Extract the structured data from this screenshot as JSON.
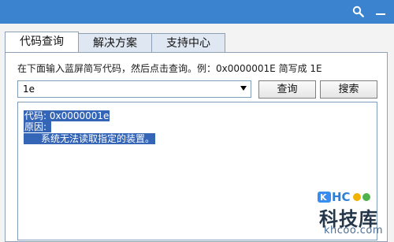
{
  "tabs": [
    {
      "label": "代码查询"
    },
    {
      "label": "解决方案"
    },
    {
      "label": "支持中心"
    }
  ],
  "instruction": "在下面输入蓝屏简写代码，然后点击查询。例：0x0000001E 简写成 1E",
  "input": {
    "value": "1e"
  },
  "buttons": {
    "query": "查询",
    "search": "搜索"
  },
  "result": {
    "line1": "代码: 0x0000001e",
    "line2": "原因:",
    "line3": "系统无法读取指定的装置。"
  },
  "watermark": {
    "brand": "KHCoo",
    "title": "科技库",
    "domain": "khcoo.com"
  },
  "icons": {
    "search_icon": "search-icon",
    "minimize_icon": "minimize-icon"
  },
  "colors": {
    "titlebar": "#3b83cf",
    "selection": "#3465b7"
  }
}
